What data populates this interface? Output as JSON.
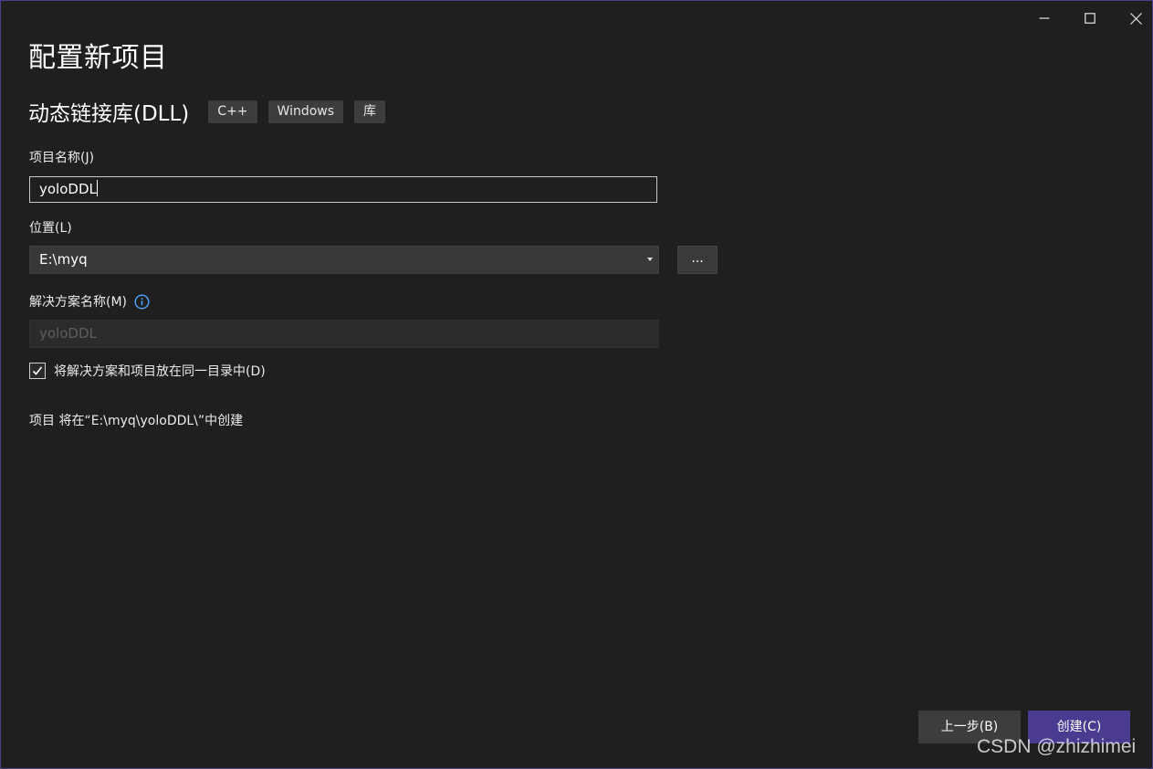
{
  "window": {
    "controls": {
      "minimize_icon": "minimize-icon",
      "maximize_icon": "maximize-icon",
      "close_icon": "close-icon"
    }
  },
  "dialog": {
    "title": "配置新项目",
    "template_name": "动态链接库(DLL)",
    "tags": [
      "C++",
      "Windows",
      "库"
    ]
  },
  "form": {
    "project_name_label": "项目名称(J)",
    "project_name_value": "yoloDDL",
    "location_label": "位置(L)",
    "location_value": "E:\\myq",
    "browse_label": "...",
    "solution_name_label": "解决方案名称(M)",
    "solution_name_value": "yoloDDL",
    "same_dir_label": "将解决方案和项目放在同一目录中(D)",
    "same_dir_checked": true,
    "summary": "项目 将在“E:\\myq\\yoloDDL\\”中创建"
  },
  "footer": {
    "back_label": "上一步(B)",
    "create_label": "创建(C)"
  },
  "watermark": "CSDN @zhizhimei",
  "colors": {
    "accent": "#4a3b91",
    "info_icon": "#4aa6ff",
    "background": "#1f1f1f"
  }
}
